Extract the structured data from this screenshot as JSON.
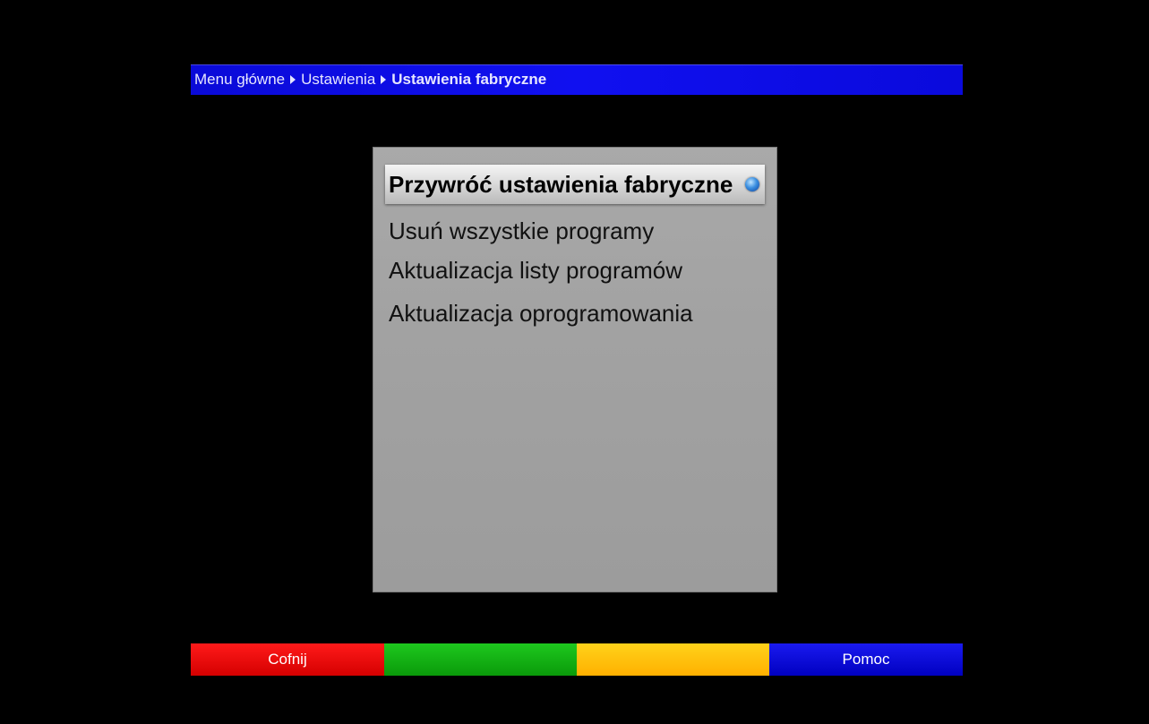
{
  "breadcrumb": {
    "items": [
      "Menu główne",
      "Ustawienia",
      "Ustawienia fabryczne"
    ]
  },
  "menu": {
    "selected_index": 0,
    "items": [
      {
        "label": "Przywróć ustawienia fabryczne",
        "icon": "ok-icon"
      },
      {
        "label": "Usuń wszystkie programy"
      },
      {
        "label": "Aktualizacja listy programów"
      },
      {
        "label": "Aktualizacja oprogramowania"
      }
    ]
  },
  "color_buttons": {
    "red": {
      "label": "Cofnij",
      "color": "#e60000"
    },
    "green": {
      "label": "",
      "color": "#12b012"
    },
    "yellow": {
      "label": "",
      "color": "#ffc000"
    },
    "blue": {
      "label": "Pomoc",
      "color": "#0a0ae0"
    }
  },
  "colors": {
    "background": "#000000",
    "breadcrumb_bar": "#0a0ae0",
    "panel": "#a5a5a5",
    "selection": "#dcdcdc"
  }
}
